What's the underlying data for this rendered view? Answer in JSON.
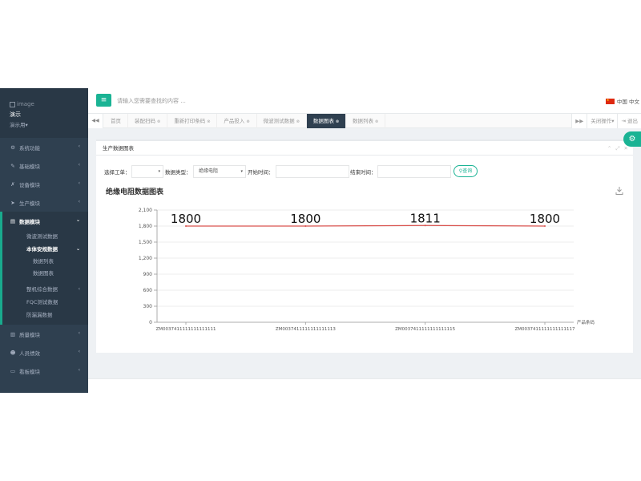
{
  "sidebar": {
    "logo_text": "image",
    "user_name": "演示",
    "user_role": "演示用",
    "role_caret": "▾",
    "items": [
      {
        "label": "系统功能",
        "icon": "gear-icon",
        "glyph": "⚙"
      },
      {
        "label": "基础模块",
        "icon": "wrench-icon",
        "glyph": "✎"
      },
      {
        "label": "设备模块",
        "icon": "tool-icon",
        "glyph": "✗"
      },
      {
        "label": "生产模块",
        "icon": "cursor-icon",
        "glyph": "➤"
      }
    ],
    "active_item": {
      "label": "数据模块",
      "icon": "file-icon",
      "glyph": "▤"
    },
    "submenu": {
      "sub1_first": "微波测试数据",
      "sub1_active": "本体安规数据",
      "sub2": [
        "数据列表",
        "数据图表"
      ],
      "sub1_rest": [
        "整机综合数据",
        "FQC测试数据",
        "防漏漏数据"
      ]
    },
    "items_bottom": [
      {
        "label": "质量模块",
        "icon": "bar-chart-icon",
        "glyph": "▥"
      },
      {
        "label": "人员绩效",
        "icon": "user-icon",
        "glyph": "☻"
      },
      {
        "label": "看板模块",
        "icon": "monitor-icon",
        "glyph": "▭"
      }
    ],
    "chevron_left": "‹",
    "chevron_down": "⌄"
  },
  "topbar": {
    "menu_glyph": "≡",
    "search_placeholder": "请输入您需要查找的内容 ...",
    "lang_label": "中国 中文",
    "flag_star": "★"
  },
  "tabs": {
    "prev_glyph": "◀◀",
    "next_glyph": "▶▶",
    "close_glyph": "⊗",
    "list": [
      {
        "label": "首页",
        "closable": false,
        "active": false
      },
      {
        "label": "装配扫码",
        "closable": true,
        "active": false
      },
      {
        "label": "重新打印条码",
        "closable": true,
        "active": false
      },
      {
        "label": "产品投入",
        "closable": true,
        "active": false
      },
      {
        "label": "微波测试数据",
        "closable": true,
        "active": false
      },
      {
        "label": "数据图表",
        "closable": true,
        "active": true
      },
      {
        "label": "数据列表",
        "closable": true,
        "active": false
      }
    ],
    "close_ops": "关闭操作",
    "close_ops_caret": "▾",
    "logout": "退出",
    "logout_glyph": "⇥"
  },
  "panel": {
    "title": "生产数据图表",
    "tool_up": "⌃",
    "tool_expand": "⤢",
    "tool_close": "✕",
    "filter": {
      "order_label": "选择工单：",
      "order_value": "",
      "type_label": "数据类型：",
      "type_value": "绝缘电阻",
      "start_label": "开始时间：",
      "start_value": "",
      "end_label": "结束时间：",
      "end_value": "",
      "query_label": "查询",
      "query_glyph": "⚲",
      "caret": "▾"
    },
    "chart_title": "绝缘电阻数据图表"
  },
  "settings_glyph": "⚙",
  "colors": {
    "sidebar_bg": "#2f4050",
    "accent": "#1ab394",
    "series_line": "#d9534f"
  },
  "chart_data": {
    "type": "line",
    "x": [
      "ZM0037411111111111111",
      "ZM0037411111111111113",
      "ZM0037411111111111115",
      "ZM0037411111111111117"
    ],
    "series": [
      {
        "values": [
          1800,
          1800,
          1811,
          1800
        ],
        "data_labels": [
          "1800",
          "1800",
          "1811",
          "1800"
        ]
      }
    ],
    "ylim": [
      0,
      2100
    ],
    "yticks": [
      0,
      300,
      600,
      900,
      1200,
      1500,
      1800,
      2100
    ],
    "ytick_labels": [
      "0",
      "300",
      "600",
      "900",
      "1,200",
      "1,500",
      "1,800",
      "2,100"
    ],
    "xlabel": "产品条码",
    "ylabel": "",
    "grid": true
  }
}
